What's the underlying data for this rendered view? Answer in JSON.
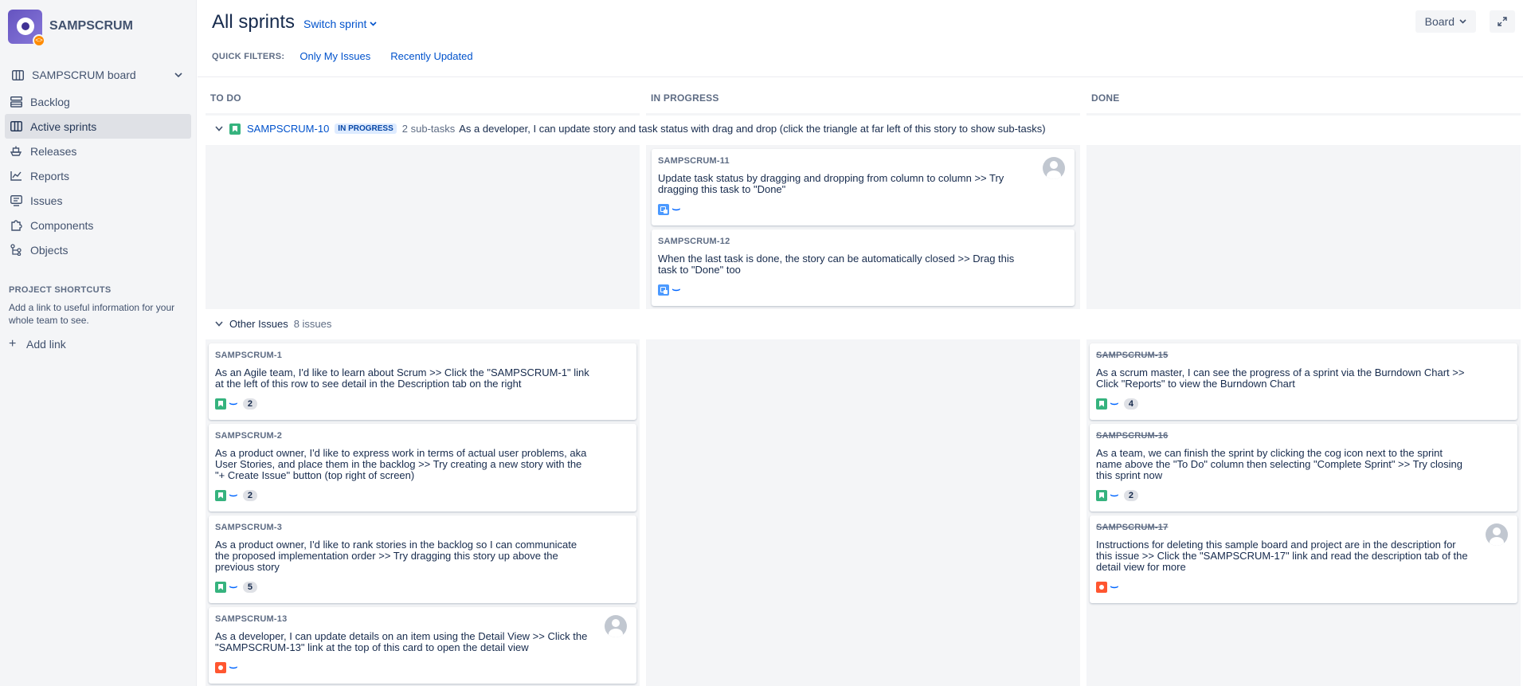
{
  "sidebar": {
    "project_name": "SAMPSCRUM",
    "board_name": "SAMPSCRUM board",
    "items": [
      {
        "label": "Backlog",
        "icon": "backlog-icon"
      },
      {
        "label": "Active sprints",
        "icon": "board-icon"
      },
      {
        "label": "Releases",
        "icon": "ship-icon"
      },
      {
        "label": "Reports",
        "icon": "chart-icon"
      },
      {
        "label": "Issues",
        "icon": "issues-icon"
      },
      {
        "label": "Components",
        "icon": "puzzle-icon"
      },
      {
        "label": "Objects",
        "icon": "tree-icon"
      }
    ],
    "active_item": "Active sprints",
    "shortcuts_title": "PROJECT SHORTCUTS",
    "shortcuts_desc": "Add a link to useful information for your whole team to see.",
    "add_link": "Add link"
  },
  "header": {
    "title": "All sprints",
    "switch_sprint": "Switch sprint",
    "board_button": "Board"
  },
  "quick_filters": {
    "label": "QUICK FILTERS:",
    "filters": [
      "Only My Issues",
      "Recently Updated"
    ]
  },
  "columns": [
    "TO DO",
    "IN PROGRESS",
    "DONE"
  ],
  "swimlanes": {
    "story": {
      "key": "SAMPSCRUM-10",
      "status": "IN PROGRESS",
      "meta": "2 sub-tasks",
      "summary": "As a developer, I can update story and task status with drag and drop (click the triangle at far left of this story to show sub-tasks)"
    },
    "other": {
      "label": "Other Issues",
      "count": "8 issues"
    }
  },
  "cards": {
    "sub1": {
      "key": "SAMPSCRUM-11",
      "summary": "Update task status by dragging and dropping from column to column >> Try dragging this task to \"Done\""
    },
    "sub2": {
      "key": "SAMPSCRUM-12",
      "summary": "When the last task is done, the story can be automatically closed >> Drag this task to \"Done\" too"
    },
    "c1": {
      "key": "SAMPSCRUM-1",
      "summary": "As an Agile team, I'd like to learn about Scrum >> Click the \"SAMPSCRUM-1\" link at the left of this row to see detail in the Description tab on the right",
      "estimate": "2"
    },
    "c2": {
      "key": "SAMPSCRUM-2",
      "summary": "As a product owner, I'd like to express work in terms of actual user problems, aka User Stories, and place them in the backlog >> Try creating a new story with the \"+ Create Issue\" button (top right of screen)",
      "estimate": "2"
    },
    "c3": {
      "key": "SAMPSCRUM-3",
      "summary": "As a product owner, I'd like to rank stories in the backlog so I can communicate the proposed implementation order >> Try dragging this story up above the previous story",
      "estimate": "5"
    },
    "c13": {
      "key": "SAMPSCRUM-13",
      "summary": "As a developer, I can update details on an item using the Detail View >> Click the \"SAMPSCRUM-13\" link at the top of this card to open the detail view"
    },
    "c15": {
      "key": "SAMPSCRUM-15",
      "summary": "As a scrum master, I can see the progress of a sprint via the Burndown Chart >> Click \"Reports\" to view the Burndown Chart",
      "estimate": "4"
    },
    "c16": {
      "key": "SAMPSCRUM-16",
      "summary": "As a team, we can finish the sprint by clicking the cog icon next to the sprint name above the \"To Do\" column then selecting \"Complete Sprint\" >> Try closing this sprint now",
      "estimate": "2"
    },
    "c17": {
      "key": "SAMPSCRUM-17",
      "summary": "Instructions for deleting this sample board and project are in the description for this issue >> Click the \"SAMPSCRUM-17\" link and read the description tab of the detail view for more"
    }
  }
}
